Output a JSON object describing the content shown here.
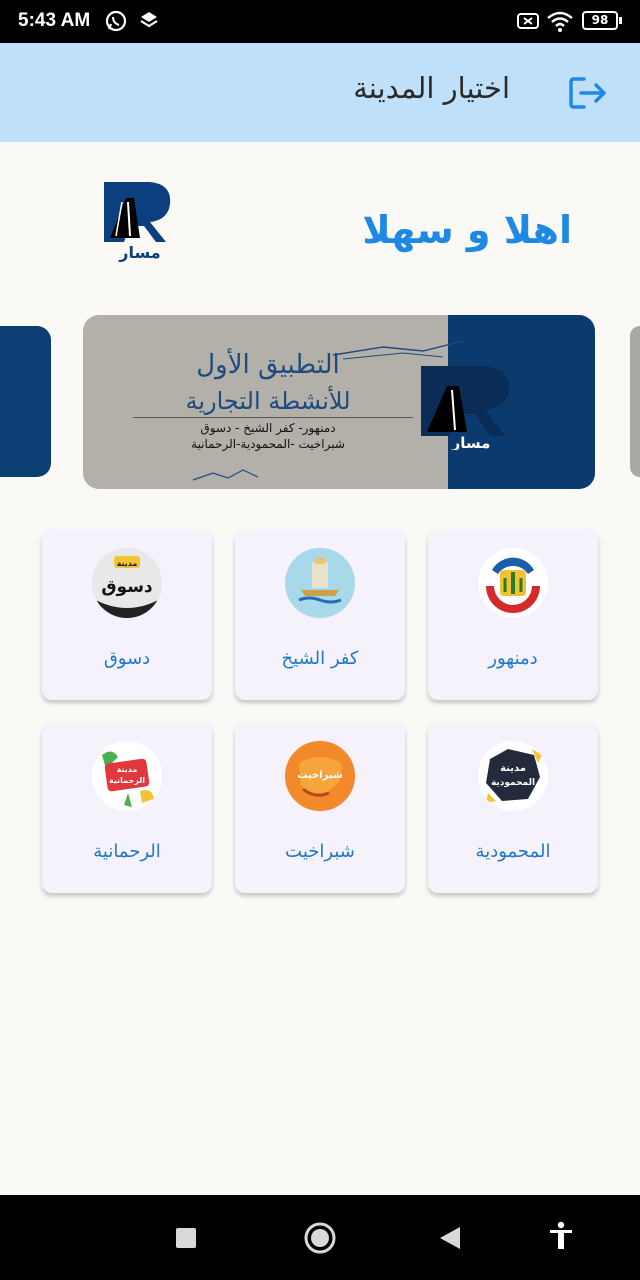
{
  "status_bar": {
    "time": "5:43 AM",
    "battery": "98"
  },
  "header": {
    "title": "اختيار المدينة",
    "exit_icon": "logout-icon"
  },
  "welcome_text": "اهلا و سهلا",
  "logo_text": "مسار",
  "banner": {
    "title_line1": "التطبيق الأول",
    "title_line2": "للأنشطة التجارية",
    "cities_line1": "دمنهور- كفر الشيخ - دسوق",
    "cities_line2": "شبراخيت -المحمودية-الرحمانية",
    "logo_text": "مسار"
  },
  "cities": [
    {
      "label": "دمنهور"
    },
    {
      "label": "كفر الشيخ"
    },
    {
      "label": "دسوق",
      "badge_top": "مدينة",
      "badge_main": "دسوق"
    },
    {
      "label": "المحمودية",
      "badge_line1": "مدينة",
      "badge_line2": "المحمودية"
    },
    {
      "label": "شبراخيت",
      "badge": "شبراخيت"
    },
    {
      "label": "الرحمانية",
      "badge_line1": "مدينة",
      "badge_line2": "الرحمانية"
    }
  ],
  "colors": {
    "primary": "#1e88e5",
    "app_bar": "#bfe0f8",
    "navy": "#0b3e73"
  }
}
